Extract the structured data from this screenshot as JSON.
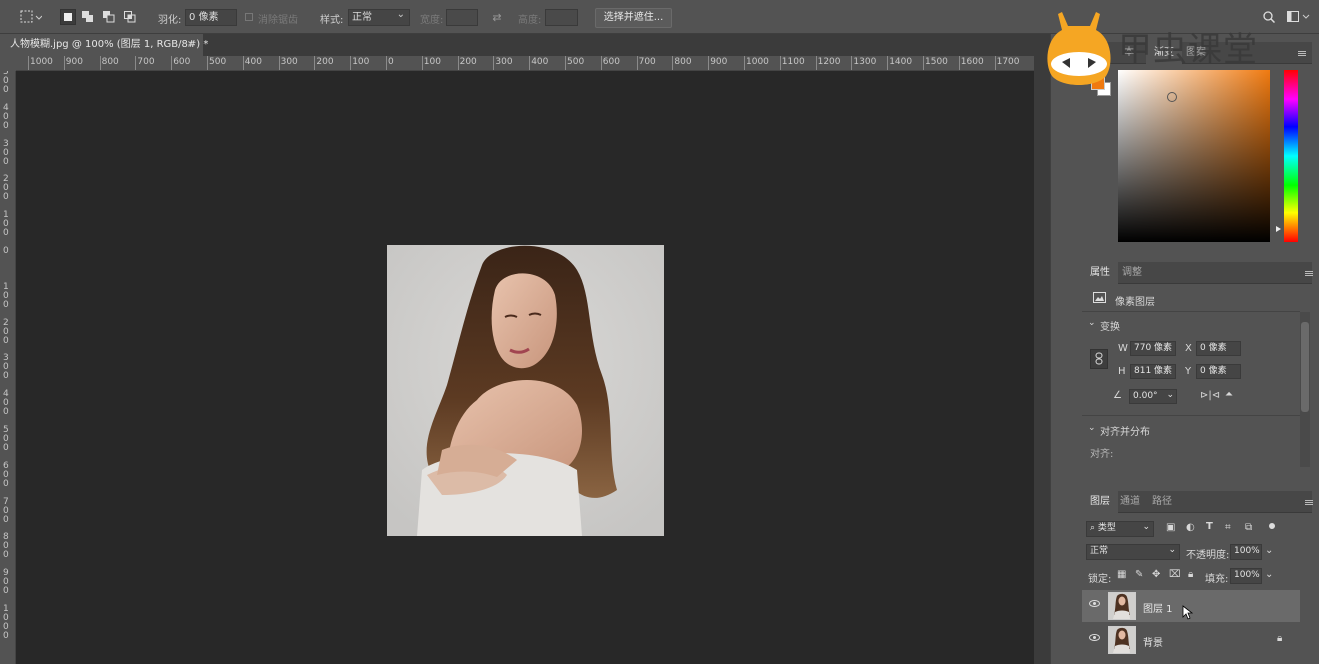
{
  "options_bar": {
    "feather_label": "羽化:",
    "feather_value": "0 像素",
    "antialias_label": "消除锯齿",
    "style_label": "样式:",
    "style_value": "正常",
    "width_label": "宽度:",
    "height_label": "高度:",
    "select_mask_button": "选择并遮住..."
  },
  "document_tab": {
    "title": "人物模糊.jpg @ 100% (图层 1, RGB/8#) *",
    "close": "×"
  },
  "rulers": {
    "horizontal_ticks": [
      "1000",
      "900",
      "800",
      "700",
      "600",
      "500",
      "400",
      "300",
      "200",
      "100",
      "0",
      "100",
      "200",
      "300",
      "400",
      "500",
      "600",
      "700",
      "800",
      "900",
      "1000",
      "1100",
      "1200",
      "1300",
      "1400",
      "1500",
      "1600",
      "1700"
    ],
    "vertical_ticks": [
      "500",
      "400",
      "300",
      "200",
      "100",
      "0",
      "100",
      "200",
      "300",
      "400",
      "500",
      "600",
      "700",
      "800",
      "900",
      "1000"
    ]
  },
  "watermark": {
    "text": "甲虫课堂"
  },
  "color_panel": {
    "tabs": [
      "色",
      "本",
      "渐变",
      "图案"
    ],
    "selected_color": "#f07a10"
  },
  "properties_panel": {
    "tabs": [
      "属性",
      "调整"
    ],
    "layer_type": "像素图层",
    "transform_label": "变换",
    "w_label": "W",
    "w_value": "770 像素",
    "h_label": "H",
    "h_value": "811 像素",
    "x_label": "X",
    "x_value": "0 像素",
    "y_label": "Y",
    "y_value": "0 像素",
    "angle_value": "0.00°",
    "align_section": "对齐并分布",
    "align_label": "对齐:"
  },
  "layers_panel": {
    "tabs": [
      "图层",
      "通道",
      "路径"
    ],
    "filter_kind": "类型",
    "blend_mode": "正常",
    "opacity_label": "不透明度:",
    "opacity_value": "100%",
    "lock_label": "锁定:",
    "fill_label": "填充:",
    "fill_value": "100%",
    "layers": [
      {
        "name": "图层 1",
        "selected": true,
        "locked": false
      },
      {
        "name": "背景",
        "selected": false,
        "locked": true
      }
    ]
  }
}
